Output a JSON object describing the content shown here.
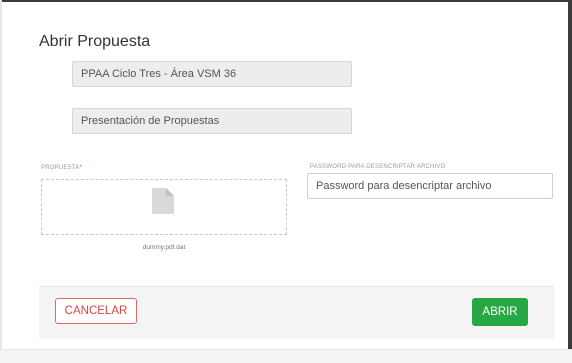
{
  "dialog": {
    "title": "Abrir Propuesta",
    "fields": {
      "process_name": "PPAA Ciclo Tres - Área VSM 36",
      "stage_name": "Presentación de Propuestas"
    },
    "proposal": {
      "label": "PROPUESTA",
      "required_mark": "*",
      "file_icon": "file-icon",
      "file_name": "dummy.pdf.dat"
    },
    "password": {
      "label": "PASSWORD PARA DESENCRIPTAR ARCHIVO",
      "placeholder": "Password para desencriptar archivo"
    },
    "buttons": {
      "cancel_label": "CANCELAR",
      "open_label": "ABRIR"
    },
    "colors": {
      "cancel_border": "#e06a6a",
      "cancel_text": "#d64545",
      "open_bg": "#28a745"
    }
  }
}
